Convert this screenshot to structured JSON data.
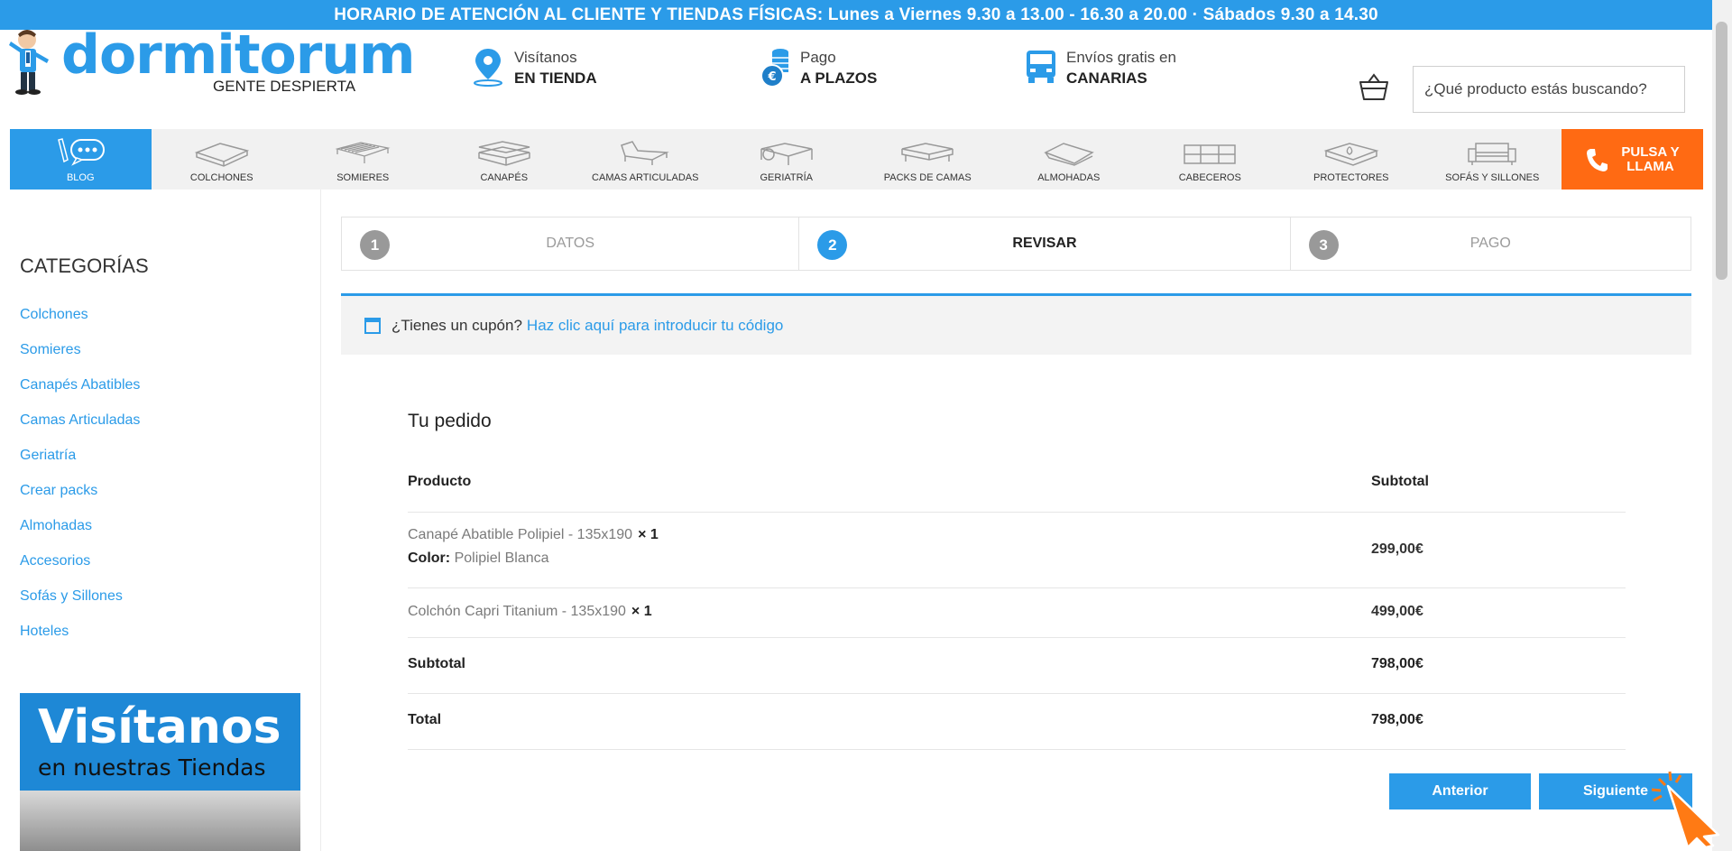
{
  "announcement": "HORARIO DE ATENCIÓN AL CLIENTE Y TIENDAS FÍSICAS: Lunes a Viernes 9.30 a 13.00 - 16.30 a 20.00 · Sábados 9.30 a 14.30",
  "logo": {
    "brand": "dormitorum",
    "tagline": "GENTE DESPIERTA"
  },
  "features": [
    {
      "line1": "Visítanos",
      "line2": "EN TIENDA",
      "icon": "map-pin-icon"
    },
    {
      "line1": "Pago",
      "line2": "A PLAZOS",
      "icon": "coins-euro-icon"
    },
    {
      "line1": "Envíos gratis en",
      "line2": "CANARIAS",
      "icon": "truck-icon"
    }
  ],
  "search": {
    "placeholder": "¿Qué producto estás buscando?"
  },
  "nav": {
    "items": [
      "BLOG",
      "COLCHONES",
      "SOMIERES",
      "CANAPÉS",
      "CAMAS ARTICULADAS",
      "GERIATRÍA",
      "PACKS DE CAMAS",
      "ALMOHADAS",
      "CABECEROS",
      "PROTECTORES",
      "SOFÁS Y SILLONES"
    ],
    "call_line1": "PULSA Y",
    "call_line2": "LLAMA"
  },
  "sidebar": {
    "title": "CATEGORÍAS",
    "categories": [
      "Colchones",
      "Somieres",
      "Canapés Abatibles",
      "Camas Articuladas",
      "Geriatría",
      "Crear packs",
      "Almohadas",
      "Accesorios",
      "Sofás y Sillones",
      "Hoteles"
    ],
    "banner_line1": "Visítanos",
    "banner_line2": "en nuestras Tiendas"
  },
  "steps": [
    {
      "num": "1",
      "label": "DATOS"
    },
    {
      "num": "2",
      "label": "REVISAR"
    },
    {
      "num": "3",
      "label": "PAGO"
    }
  ],
  "coupon": {
    "text": "¿Tienes un cupón?",
    "link": "Haz clic aquí para introducir tu código"
  },
  "order": {
    "title": "Tu pedido",
    "col_product": "Producto",
    "col_subtotal": "Subtotal",
    "items": [
      {
        "name": "Canapé Abatible Polipiel - 135x190",
        "qty": "× 1",
        "meta_label": "Color:",
        "meta_value": "Polipiel Blanca",
        "price": "299,00€"
      },
      {
        "name": "Colchón Capri Titanium - 135x190",
        "qty": "× 1",
        "price": "499,00€"
      }
    ],
    "subtotal_label": "Subtotal",
    "subtotal_value": "798,00€",
    "total_label": "Total",
    "total_value": "798,00€"
  },
  "buttons": {
    "prev": "Anterior",
    "next": "Siguiente"
  },
  "colors": {
    "accent": "#2b9be8",
    "call": "#ff6a13"
  }
}
